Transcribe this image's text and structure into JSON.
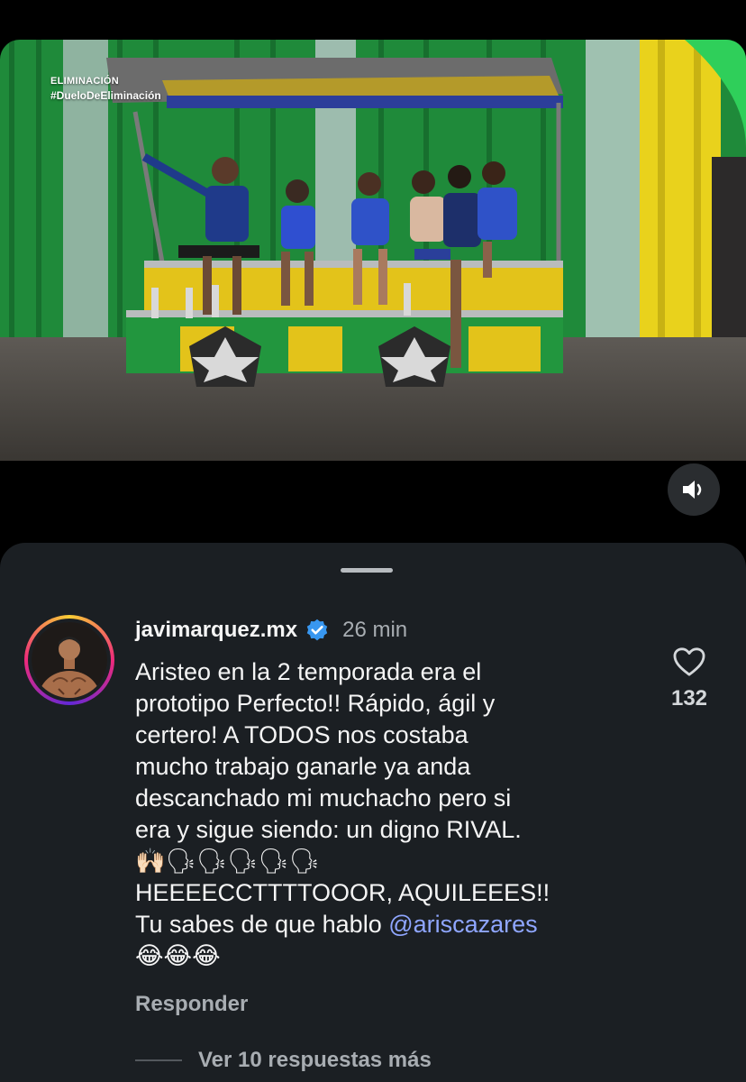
{
  "video": {
    "tag_line1": "ELIMINACIÓN",
    "tag_line2": "#DueloDeEliminación",
    "mute_icon": "speaker-icon"
  },
  "comment": {
    "username": "javimarquez.mx",
    "verified_icon": "verified-badge-icon",
    "time": "26 min",
    "text_lines": [
      "Aristeo en la 2 temporada era  el",
      "prototipo Perfecto!! Rápido, ágil y",
      "certero! A TODOS nos costaba",
      "mucho trabajo ganarle ya anda",
      "descanchado mi muchacho pero si",
      "era y sigue siendo: un digno RIVAL.",
      "🙌🏻🗣🗣🗣🗣🗣",
      "HEEEECCTTTTOOOR, AQUILEEES!!",
      "Tu sabes de que hablo "
    ],
    "mention": "@ariscazares",
    "last_line": "😂😂😂",
    "likes": "132",
    "reply_label": "Responder",
    "more_replies_label": "Ver 10 respuestas más"
  },
  "colors": {
    "sheet_bg": "#1b1f23",
    "mention": "#8fa6ff",
    "verified": "#3897f0"
  }
}
